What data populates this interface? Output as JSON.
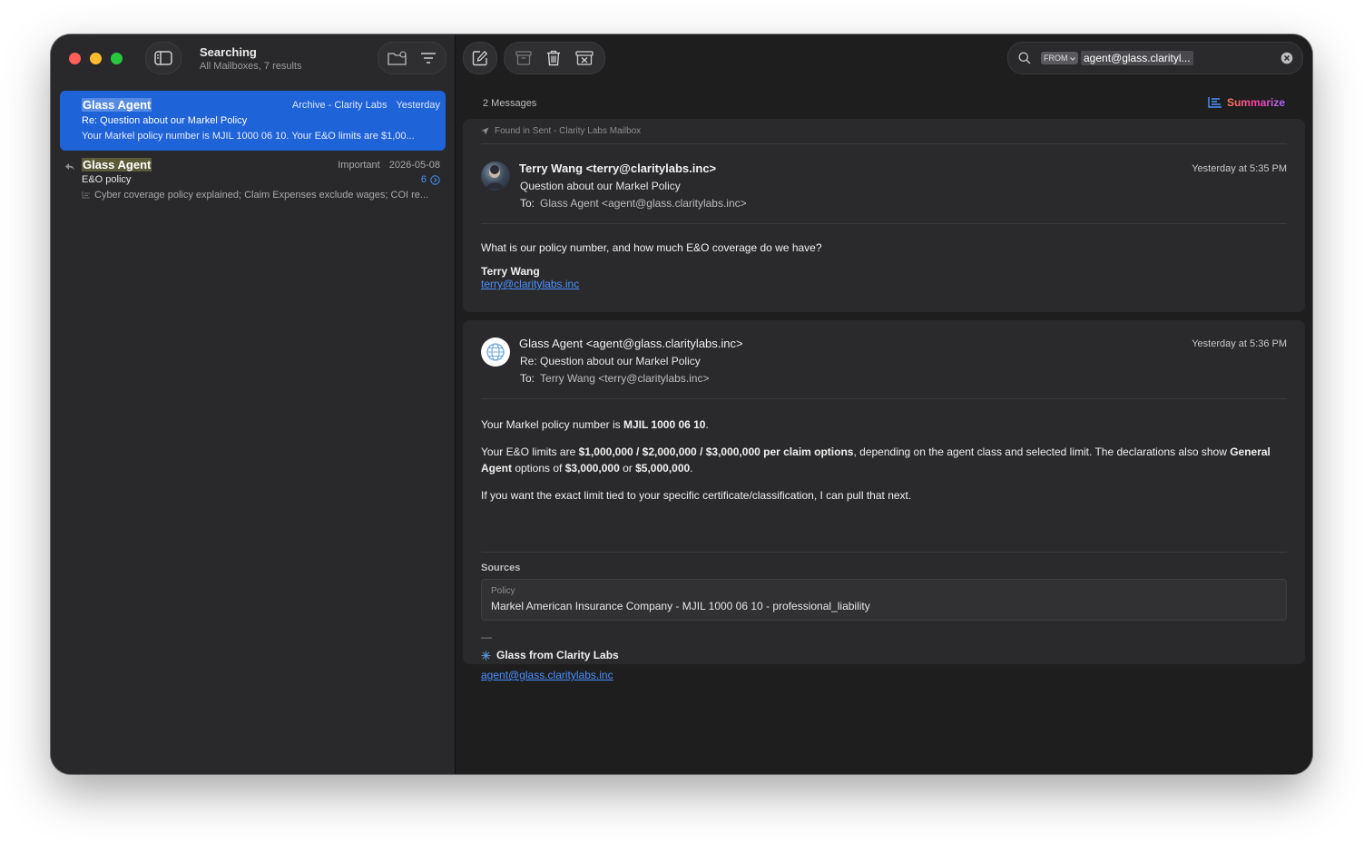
{
  "sidebar": {
    "title": "Searching",
    "subtitle": "All Mailboxes, 7 results",
    "messages": [
      {
        "sender": "Glass Agent",
        "mailbox": "Archive - Clarity Labs",
        "date": "Yesterday",
        "subject": "Re: Question about our Markel Policy",
        "preview": "Your Markel policy number is MJIL 1000 06 10. Your E&O limits are $1,00..."
      },
      {
        "sender": "Glass Agent",
        "mailbox": "Important",
        "date": "2026-05-08",
        "subject": "E&O policy",
        "count": "6",
        "preview": "Cyber coverage policy explained; Claim Expenses exclude wages; COI re..."
      }
    ]
  },
  "search": {
    "token": "FROM",
    "query": "agent@glass.clarityl..."
  },
  "thread": {
    "count_label": "2 Messages",
    "summarize_label": "Summarize",
    "found_in": "Found in Sent - Clarity Labs Mailbox",
    "message1": {
      "from": "Terry Wang <terry@claritylabs.inc>",
      "subject": "Question about our Markel Policy",
      "to_label": "To:",
      "to": "Glass Agent <agent@glass.claritylabs.inc>",
      "date": "Yesterday at 5:35 PM",
      "body": "What is our policy number, and how much E&O coverage do we have?",
      "sig_name": "Terry Wang",
      "sig_email": "terry@claritylabs.inc"
    },
    "message2": {
      "from": "Glass Agent <agent@glass.claritylabs.inc>",
      "subject": "Re: Question about our Markel Policy",
      "to_label": "To:",
      "to": "Terry Wang <terry@claritylabs.inc>",
      "date": "Yesterday at 5:36 PM",
      "p1_a": "Your Markel policy number is ",
      "p1_b": "MJIL 1000 06 10",
      "p1_c": ".",
      "p2_a": "Your E&O limits are ",
      "p2_b": "$1,000,000 / $2,000,000 / $3,000,000 per claim options",
      "p2_c": ", depending on the agent class and selected limit. The declarations also show ",
      "p2_d": "General Agent",
      "p2_e": " options of ",
      "p2_f": "$3,000,000",
      "p2_g": " or ",
      "p2_h": "$5,000,000",
      "p2_i": ".",
      "p3": "If you want the exact limit tied to your specific certificate/classification, I can pull that next.",
      "sources_label": "Sources",
      "source_key": "Policy",
      "source_value": "Markel American Insurance Company - MJIL 1000 06 10 - professional_liability",
      "sig_dash": "—",
      "sig_name": "Glass from Clarity Labs",
      "sig_email": "agent@glass.claritylabs.inc"
    }
  },
  "colors": {
    "accent": "#1f63d8",
    "link": "#4a90ff",
    "background": "#1e1e1f"
  }
}
